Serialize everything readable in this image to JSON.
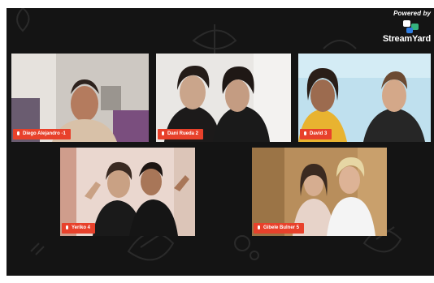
{
  "branding": {
    "powered_text": "Powered by",
    "product_name": "StreamYard",
    "logo_icon": "streamyard-logo"
  },
  "colors": {
    "background": "#141414",
    "label_bg": "#e8412b",
    "label_text": "#ffffff"
  },
  "participants": [
    {
      "name": "Diego Alejandro -1"
    },
    {
      "name": "Dani Rueda 2"
    },
    {
      "name": "David 3"
    },
    {
      "name": "Yeriko 4"
    },
    {
      "name": "Gibele Bulner 5"
    }
  ]
}
